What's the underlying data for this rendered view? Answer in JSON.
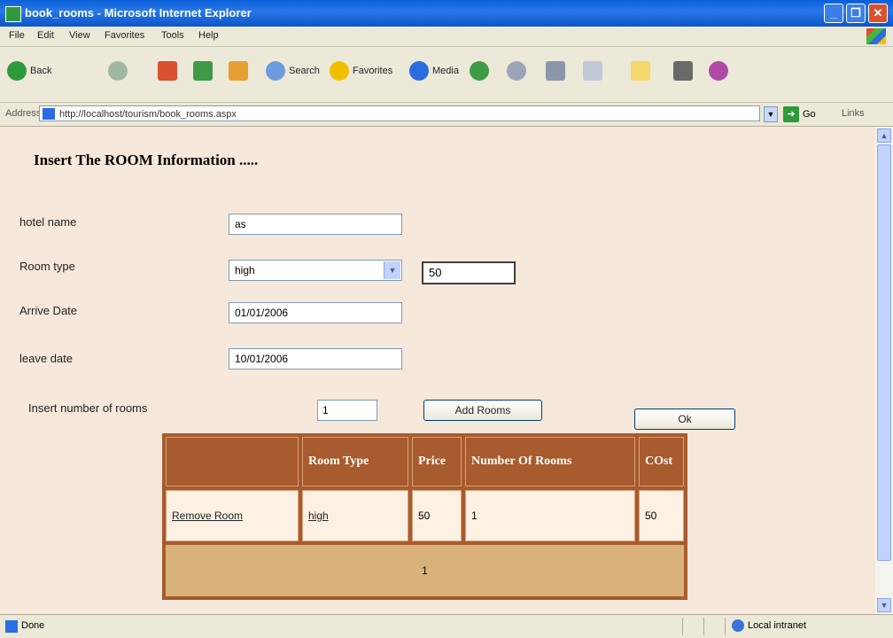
{
  "window": {
    "title": "book_rooms - Microsoft Internet Explorer",
    "min_glyph": "_",
    "max_glyph": "❐",
    "close_glyph": "✕"
  },
  "menu": [
    "File",
    "Edit",
    "View",
    "Favorites",
    "Tools",
    "Help"
  ],
  "toolbar": {
    "back_label": "Back",
    "search_label": "Search",
    "favorites_label": "Favorites",
    "media_label": "Media"
  },
  "address": {
    "label": "Address",
    "url": "http://localhost/tourism/book_rooms.aspx",
    "go_label": "Go",
    "links_label": "Links"
  },
  "form": {
    "heading": "Insert The ROOM Information .....",
    "hotel_label": "hotel name",
    "hotel_value": "as",
    "room_type_label": "Room type",
    "room_type_value": "high",
    "price_value": "50",
    "arrive_label": "Arrive Date",
    "arrive_value": "01/01/2006",
    "leave_label": "leave date",
    "leave_value": "10/01/2006",
    "rooms_label": "Insert number of rooms",
    "rooms_value": "1",
    "add_button": "Add Rooms",
    "ok_button": "Ok"
  },
  "table": {
    "headers": [
      "",
      "Room Type",
      "Price",
      "Number Of Rooms",
      "COst"
    ],
    "rows": [
      {
        "action": "Remove Room",
        "room_type": "high",
        "price": "50",
        "rooms": "1",
        "cost": "50"
      }
    ],
    "pager": "1"
  },
  "status": {
    "text": "Done",
    "zone": "Local intranet"
  },
  "colors": {
    "header_bg": "#a85b2e",
    "pager_bg": "#d9b27a",
    "page_bg": "#f6e8da"
  }
}
